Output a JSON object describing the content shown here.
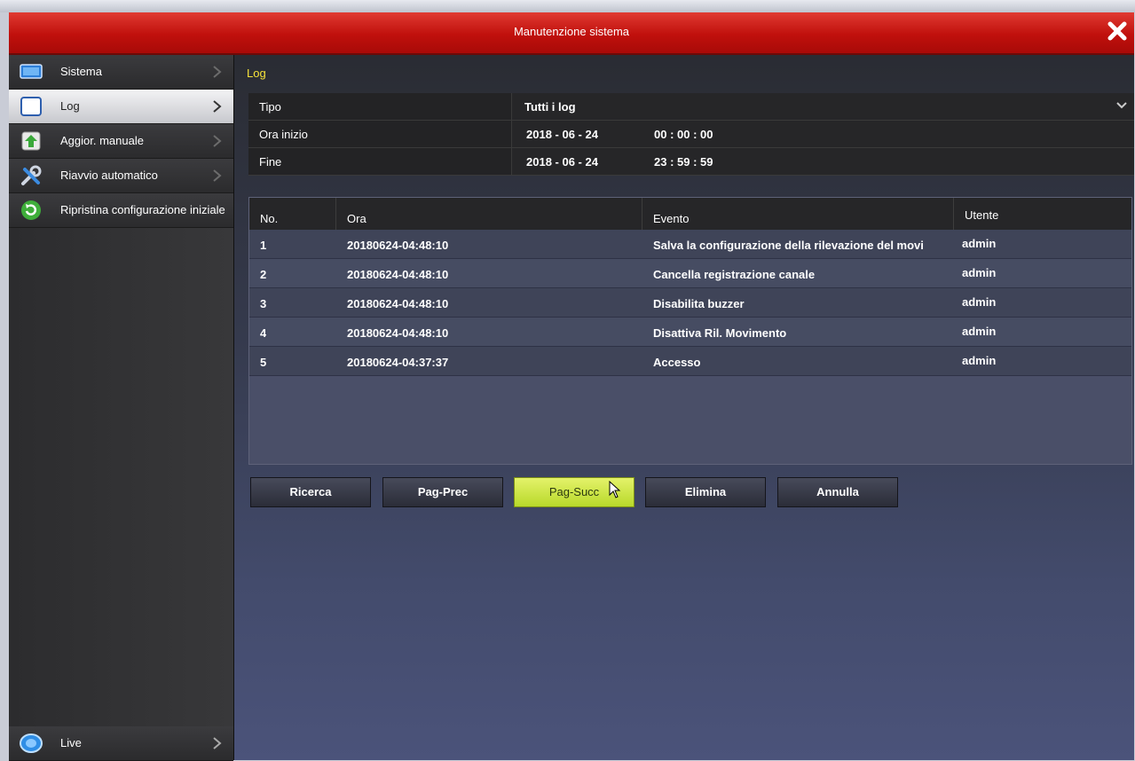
{
  "window": {
    "title": "Manutenzione sistema"
  },
  "sidebar": {
    "items": [
      {
        "label": "Sistema",
        "icon": "monitor-icon"
      },
      {
        "label": "Log",
        "icon": "log-icon"
      },
      {
        "label": "Aggior. manuale",
        "icon": "upgrade-arrow-icon"
      },
      {
        "label": "Riavvio automatico",
        "icon": "tools-icon"
      },
      {
        "label": "Ripristina configurazione iniziale",
        "icon": "restore-icon"
      }
    ],
    "live": {
      "label": "Live",
      "icon": "live-icon"
    }
  },
  "breadcrumb": "Log",
  "filters": {
    "type": {
      "label": "Tipo",
      "value": "Tutti i log"
    },
    "start": {
      "label": "Ora inizio",
      "date": "2018  -  06  -  24",
      "time": "00  :  00  :  00"
    },
    "end": {
      "label": "Fine",
      "date": "2018  -  06  -  24",
      "time": "23  :  59  :  59"
    }
  },
  "table": {
    "headers": [
      "No.",
      "Ora",
      "Evento",
      "Utente"
    ],
    "rows": [
      [
        "1",
        "20180624-04:48:10",
        "Salva la configurazione della rilevazione del movi",
        "admin"
      ],
      [
        "2",
        "20180624-04:48:10",
        "Cancella registrazione canale",
        "admin"
      ],
      [
        "3",
        "20180624-04:48:10",
        "Disabilita buzzer",
        "admin"
      ],
      [
        "4",
        "20180624-04:48:10",
        "Disattiva Ril. Movimento",
        "admin"
      ],
      [
        "5",
        "20180624-04:37:37",
        "Accesso",
        "admin"
      ]
    ]
  },
  "buttons": {
    "search": "Ricerca",
    "prev": "Pag-Prec",
    "next": "Pag-Succ",
    "delete": "Elimina",
    "cancel": "Annulla"
  },
  "colors": {
    "titlebar": "#c0100c",
    "breadcrumb": "#f5e23a",
    "highlight_button": "#d4e94a"
  }
}
